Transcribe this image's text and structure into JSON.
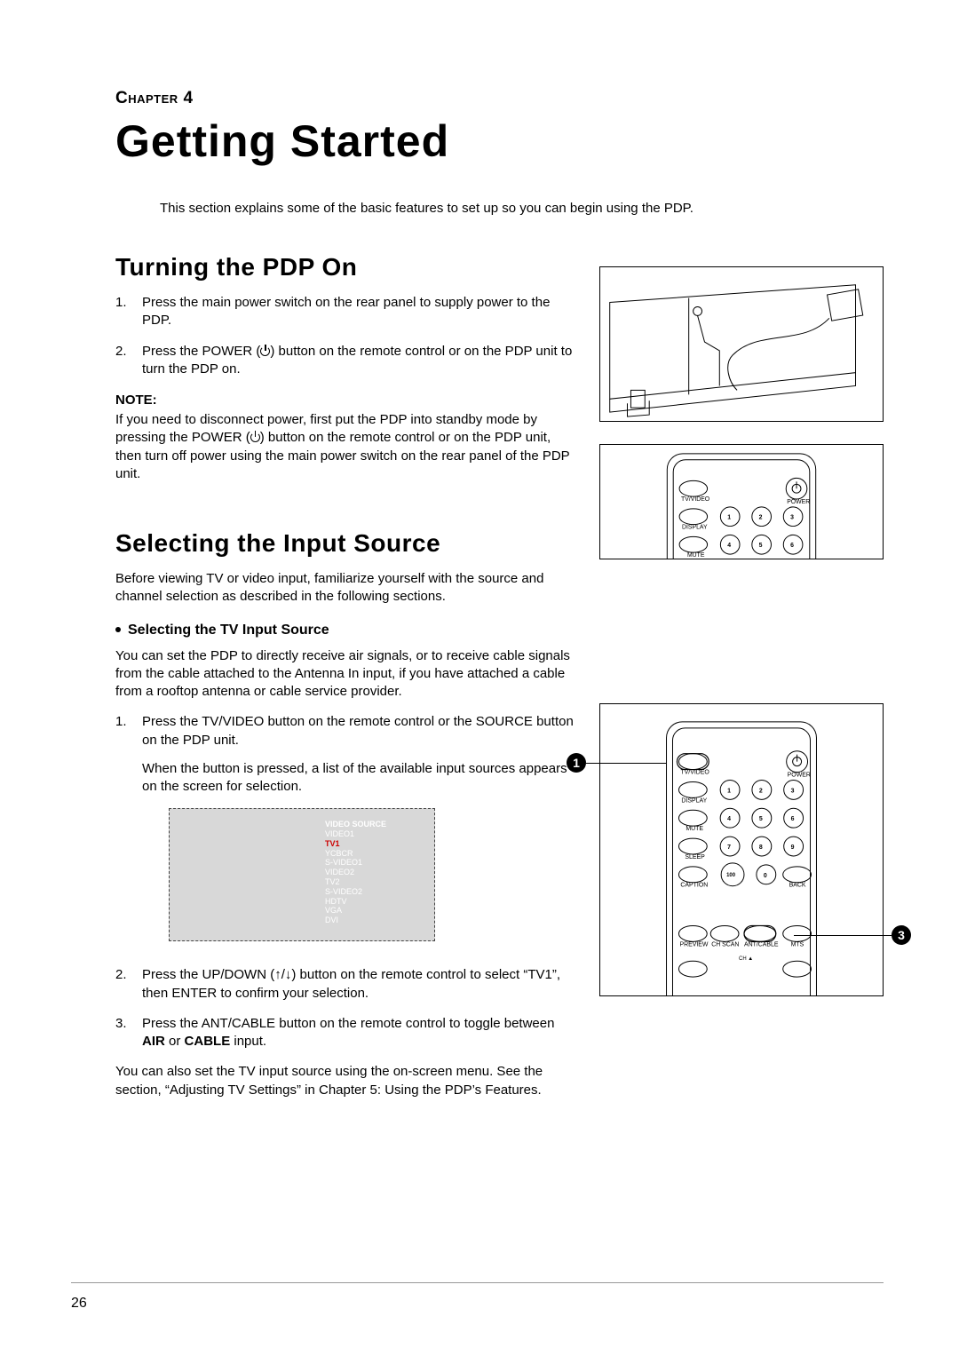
{
  "chapter_label": "Chapter 4",
  "main_title": "Getting Started",
  "intro": "This section explains some of the basic features to set up so you can begin using the PDP.",
  "sec1": {
    "title": "Turning the PDP On",
    "steps": [
      {
        "num": "1.",
        "body": "Press the main power switch on the rear panel to supply power to the PDP."
      },
      {
        "num": "2.",
        "body_pre": "Press the POWER (",
        "body_post": ") button on the remote control or on the PDP unit to turn the PDP on."
      }
    ],
    "note_label": "NOTE:",
    "note_body_pre": "If you need to disconnect power, first put the PDP into standby mode by pressing the POWER (",
    "note_body_post": ") button on the remote control or on the PDP unit, then turn off power using the main power switch on the rear panel of the PDP unit."
  },
  "sec2": {
    "title": "Selecting the Input Source",
    "intro": "Before viewing TV or video input, familiarize yourself with the source and channel selection as described in the following sections.",
    "sub_title": "Selecting the TV Input Source",
    "para1": "You can set the PDP to directly receive air signals, or to receive cable signals from the cable attached to the Antenna In input, if you have attached a cable from a rooftop antenna or cable service provider.",
    "steps": [
      {
        "num": "1.",
        "body": "Press the TV/VIDEO button on the remote control or the SOURCE button on the PDP unit.",
        "indent": "When the button is pressed, a list of the available input sources appears on the screen for selection."
      },
      {
        "num": "2.",
        "body_pre": "Press the UP/DOWN (",
        "arrows": "↑/↓",
        "body_post": ") button on the remote control to select “TV1”, then ENTER to confirm your selection."
      },
      {
        "num": "3.",
        "body_pre": "Press the ANT/CABLE button on the remote control to toggle between ",
        "bold1": "AIR",
        "mid": " or ",
        "bold2": "CABLE",
        "body_post": " input."
      }
    ],
    "outro": "You can also set the TV input source using the on-screen menu. See the section, “Adjusting TV Settings” in Chapter 5: Using the PDP’s Features."
  },
  "video_source": {
    "header": "VIDEO SOURCE",
    "items": [
      "VIDEO1",
      "TV1",
      "YCBCR",
      "S-VIDEO1",
      "VIDEO2",
      "TV2",
      "S-VIDEO2",
      "HDTV",
      "VGA",
      "DVI"
    ],
    "selected_index": 1
  },
  "remote": {
    "tvvideo": "TV/VIDEO",
    "power": "POWER",
    "display": "DISPLAY",
    "mute": "MUTE",
    "sleep": "SLEEP",
    "caption": "CAPTION",
    "back": "BACK",
    "preview": "PREVIEW",
    "chscan": "CH SCAN",
    "antcable": "ANT/CABLE",
    "mts": "MTS",
    "ch": "CH"
  },
  "markers": {
    "m1": "1",
    "m3": "3"
  },
  "page_number": "26"
}
